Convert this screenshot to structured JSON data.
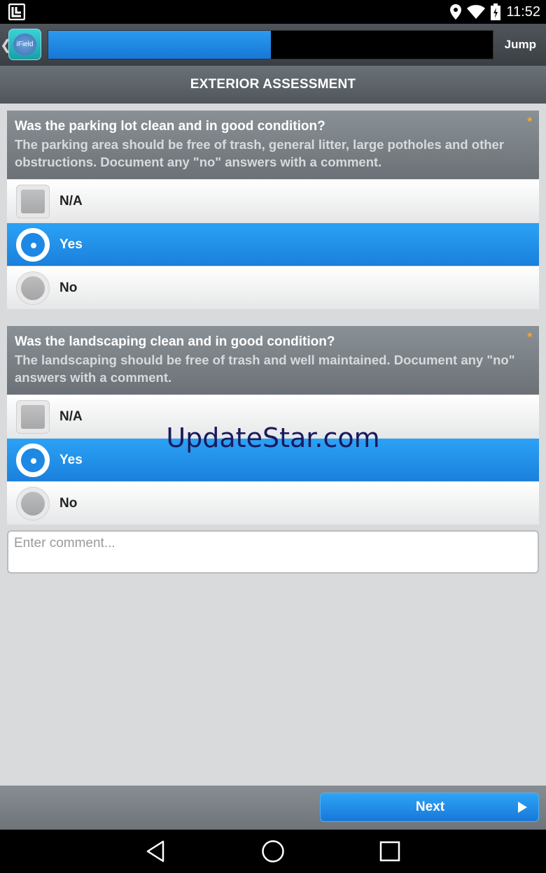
{
  "status_bar": {
    "time": "11:52",
    "icons": [
      "app-notification-icon",
      "location-icon",
      "wifi-icon",
      "battery-charging-icon"
    ]
  },
  "header": {
    "logo_text": "iField",
    "progress_percent": 50,
    "jump_label": "Jump"
  },
  "section": {
    "title": "EXTERIOR ASSESSMENT"
  },
  "questions": [
    {
      "title": "Was the parking lot clean and in good condition?",
      "description": "The parking area should be free of trash, general litter, large potholes and other obstructions. Document any \"no\" answers with a comment.",
      "required_marker": "*",
      "options": [
        {
          "label": "N/A",
          "type": "checkbox",
          "selected": false
        },
        {
          "label": "Yes",
          "type": "radio",
          "selected": true
        },
        {
          "label": "No",
          "type": "radio",
          "selected": false
        }
      ]
    },
    {
      "title": "Was the landscaping clean and in good condition?",
      "description": "The landscaping should be free of trash and well maintained. Document any \"no\" answers with a comment.",
      "required_marker": "*",
      "options": [
        {
          "label": "N/A",
          "type": "checkbox",
          "selected": false
        },
        {
          "label": "Yes",
          "type": "radio",
          "selected": true
        },
        {
          "label": "No",
          "type": "radio",
          "selected": false
        }
      ]
    }
  ],
  "comment": {
    "placeholder": "Enter comment..."
  },
  "watermark": "UpdateStar.com",
  "footer": {
    "next_label": "Next"
  },
  "colors": {
    "accent": "#1a80dc",
    "required": "#ffa82b",
    "header_bg": "#4f555b"
  }
}
